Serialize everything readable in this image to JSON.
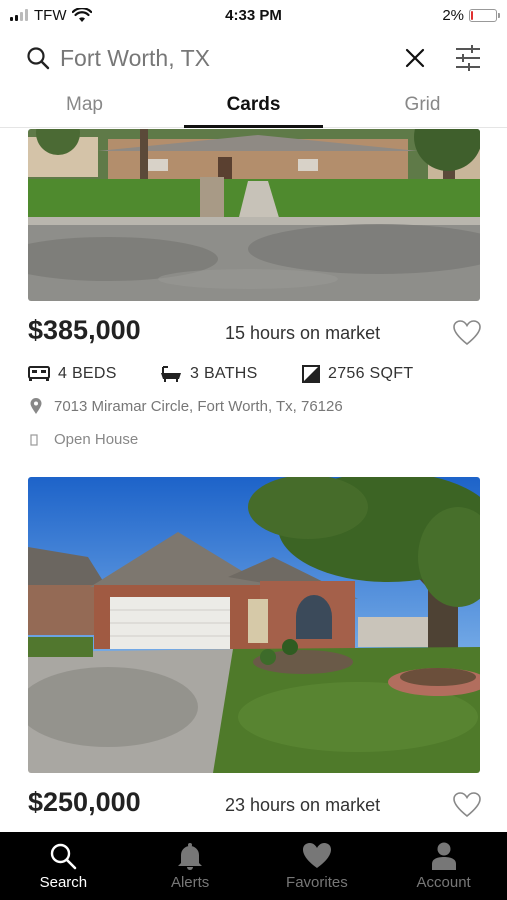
{
  "status_bar": {
    "carrier": "TFW",
    "time": "4:33 PM",
    "battery": "2%"
  },
  "search": {
    "value": "Fort Worth, TX"
  },
  "tabs": [
    {
      "label": "Map",
      "active": false
    },
    {
      "label": "Cards",
      "active": true
    },
    {
      "label": "Grid",
      "active": false
    }
  ],
  "listings": [
    {
      "price": "$385,000",
      "time_on_market": "15 hours on market",
      "beds": "4 BEDS",
      "baths": "3 BATHS",
      "sqft": "2756 SQFT",
      "address": "7013 Miramar Circle, Fort Worth, Tx, 76126",
      "open_house": "Open House"
    },
    {
      "price": "$250,000",
      "time_on_market": "23 hours on market"
    }
  ],
  "bottom_nav": [
    {
      "label": "Search",
      "icon": "search-icon",
      "active": true
    },
    {
      "label": "Alerts",
      "icon": "bell-icon",
      "active": false
    },
    {
      "label": "Favorites",
      "icon": "heart-icon",
      "active": false
    },
    {
      "label": "Account",
      "icon": "person-icon",
      "active": false
    }
  ],
  "colors": {
    "nav_background": "#000000",
    "battery_low": "#e03030",
    "accent": "#111111"
  }
}
